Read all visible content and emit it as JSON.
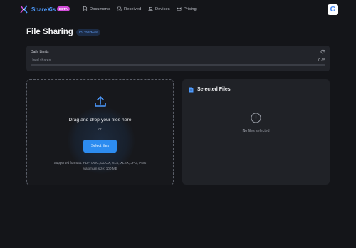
{
  "header": {
    "brand": "ShareXis",
    "badge": "BETA",
    "nav": [
      {
        "label": "Documents",
        "icon": "document-icon"
      },
      {
        "label": "Received",
        "icon": "inbox-icon"
      },
      {
        "label": "Devices",
        "icon": "laptop-icon"
      },
      {
        "label": "Pricing",
        "icon": "crown-icon"
      }
    ],
    "google_letter": "G"
  },
  "page": {
    "title": "File Sharing",
    "id_badge": "ID: 7h6f3ed8"
  },
  "limits": {
    "title": "Daily Limits",
    "label": "Used shares",
    "count": "0 / 5",
    "progress_fraction": 0
  },
  "dropzone": {
    "title": "Drag and drop your files here",
    "or": "or",
    "button": "Select files",
    "formats": "Supported formats: PDF, DOC, DOCX, XLS, XLSX, JPG, PNG",
    "max_size": "Maximum size: 100 MB"
  },
  "selected": {
    "title": "Selected Files",
    "empty": "No files selected"
  },
  "colors": {
    "accent": "#2d8cf0",
    "brand": "#4d9bff",
    "badge": "#d14bd8",
    "background": "#141519"
  }
}
